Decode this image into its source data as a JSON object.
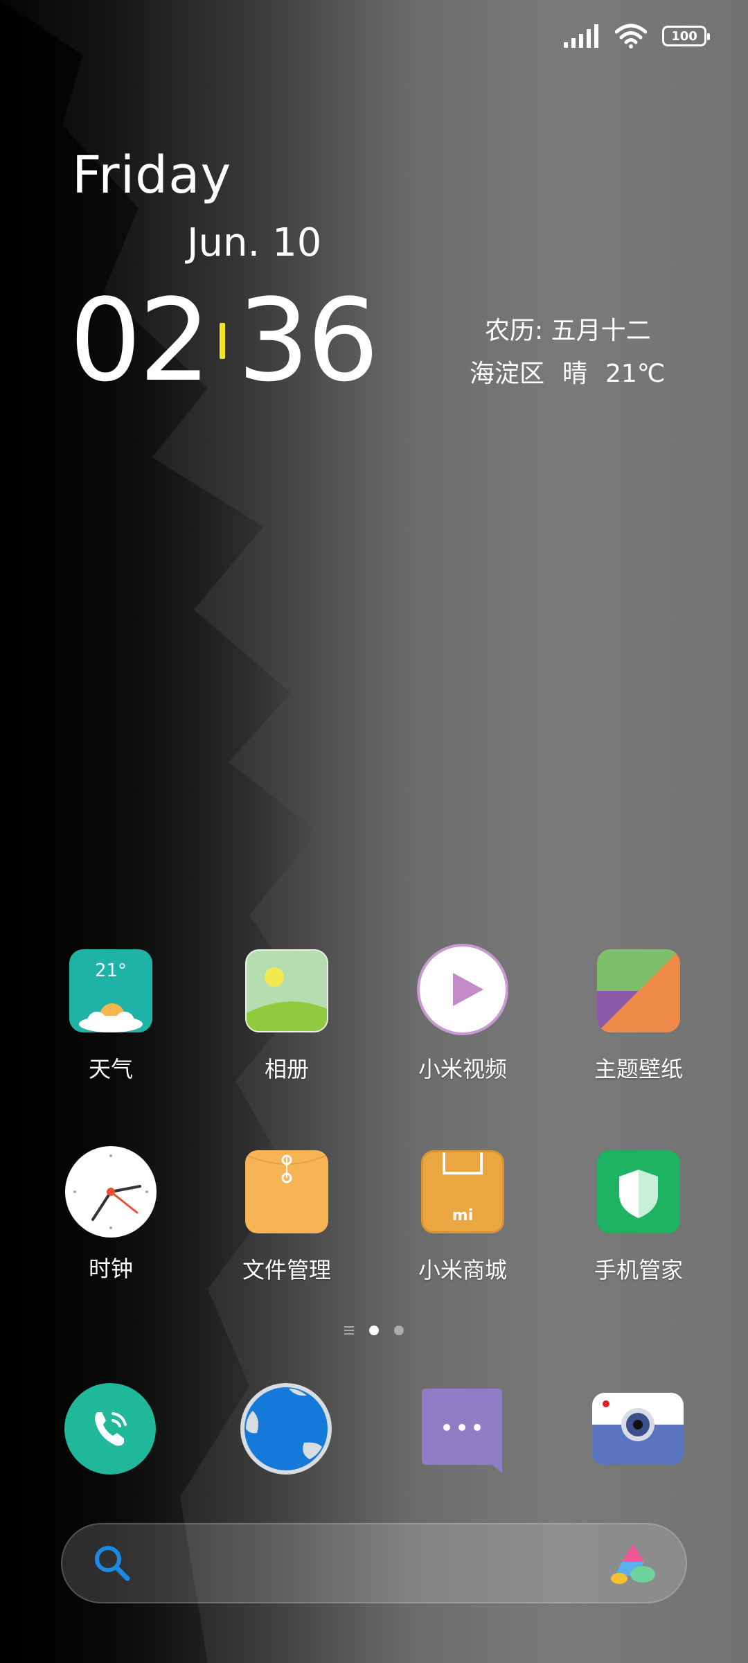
{
  "status_bar": {
    "battery": "100",
    "icons": [
      "signal-icon",
      "wifi-icon",
      "battery-icon"
    ]
  },
  "clock_widget": {
    "day": "Friday",
    "date": "Jun. 10",
    "hours": "02",
    "minutes": "36",
    "lunar": "农历: 五月十二",
    "location": "海淀区",
    "condition": "晴",
    "temperature": "21℃"
  },
  "apps": [
    {
      "label": "天气",
      "icon": "weather-icon",
      "temp": "21°"
    },
    {
      "label": "相册",
      "icon": "gallery-icon"
    },
    {
      "label": "小米视频",
      "icon": "video-icon"
    },
    {
      "label": "主题壁纸",
      "icon": "themes-icon"
    },
    {
      "label": "时钟",
      "icon": "clock-icon"
    },
    {
      "label": "文件管理",
      "icon": "file-manager-icon"
    },
    {
      "label": "小米商城",
      "icon": "mi-store-icon",
      "badge": "mi"
    },
    {
      "label": "手机管家",
      "icon": "security-icon"
    }
  ],
  "page_indicator": {
    "pages": 2,
    "current": 1
  },
  "dock": [
    {
      "icon": "phone-icon"
    },
    {
      "icon": "browser-icon"
    },
    {
      "icon": "messages-icon"
    },
    {
      "icon": "camera-icon"
    }
  ],
  "search": {
    "placeholder": "",
    "icon": "search-icon",
    "assistant_icon": "assistant-icon"
  },
  "colors": {
    "accent_colon": "#f4e623",
    "weather_teal": "#1fb3a8",
    "phone_green": "#1fb99a",
    "security_green": "#1db362"
  }
}
